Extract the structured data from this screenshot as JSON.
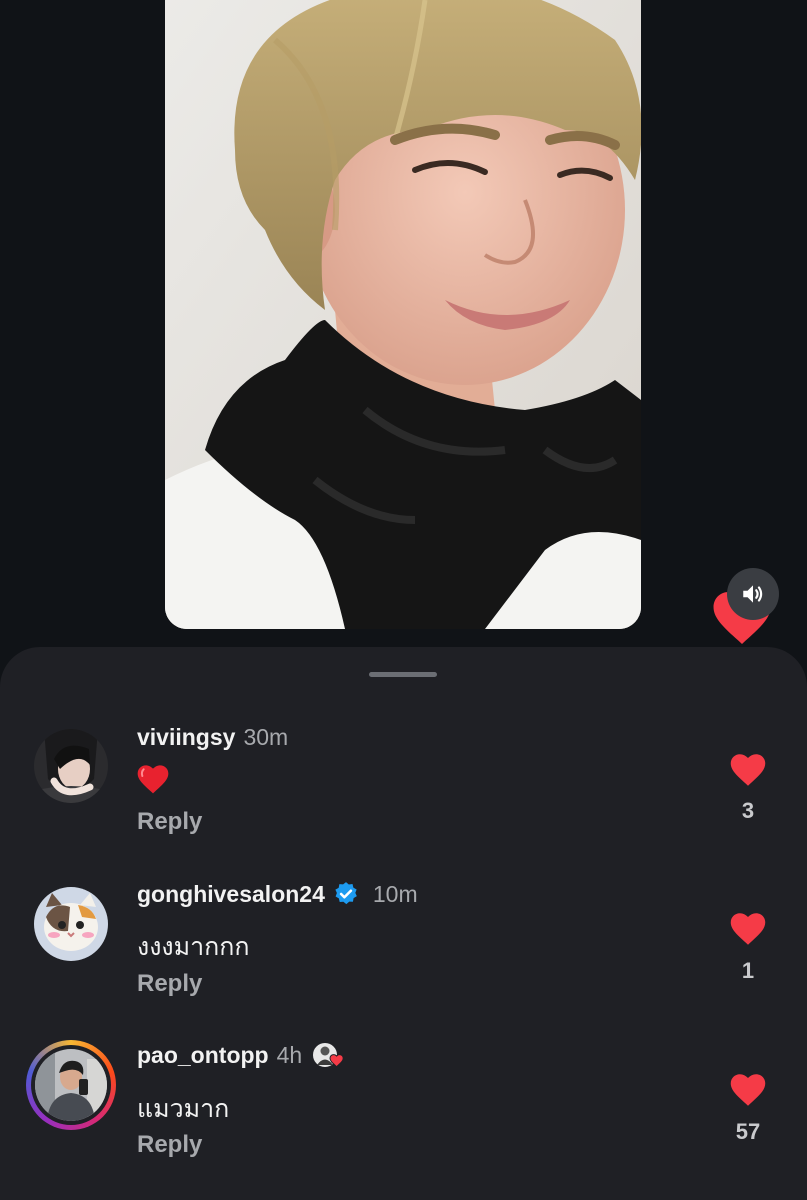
{
  "video": {
    "volume_icon": "speaker-icon",
    "reaction_icon": "heart-icon",
    "accent": "#f53b47"
  },
  "comments": [
    {
      "username": "viviingsy",
      "time": "30m",
      "text": "❤️",
      "reply_label": "Reply",
      "likes": "3"
    },
    {
      "username": "gonghivesalon24",
      "time": "10m",
      "verified": true,
      "text": "งงงมากกก",
      "reply_label": "Reply",
      "likes": "1"
    },
    {
      "username": "pao_ontopp",
      "time": "4h",
      "liked_by_creator": true,
      "text": "แมวมาก",
      "reply_label": "Reply",
      "likes": "57"
    }
  ],
  "colors": {
    "background": "#101317",
    "sheet": "#1f2025",
    "heart": "#f53b47",
    "verified": "#1d9bf0",
    "secondary_text": "#a7a9ad"
  }
}
